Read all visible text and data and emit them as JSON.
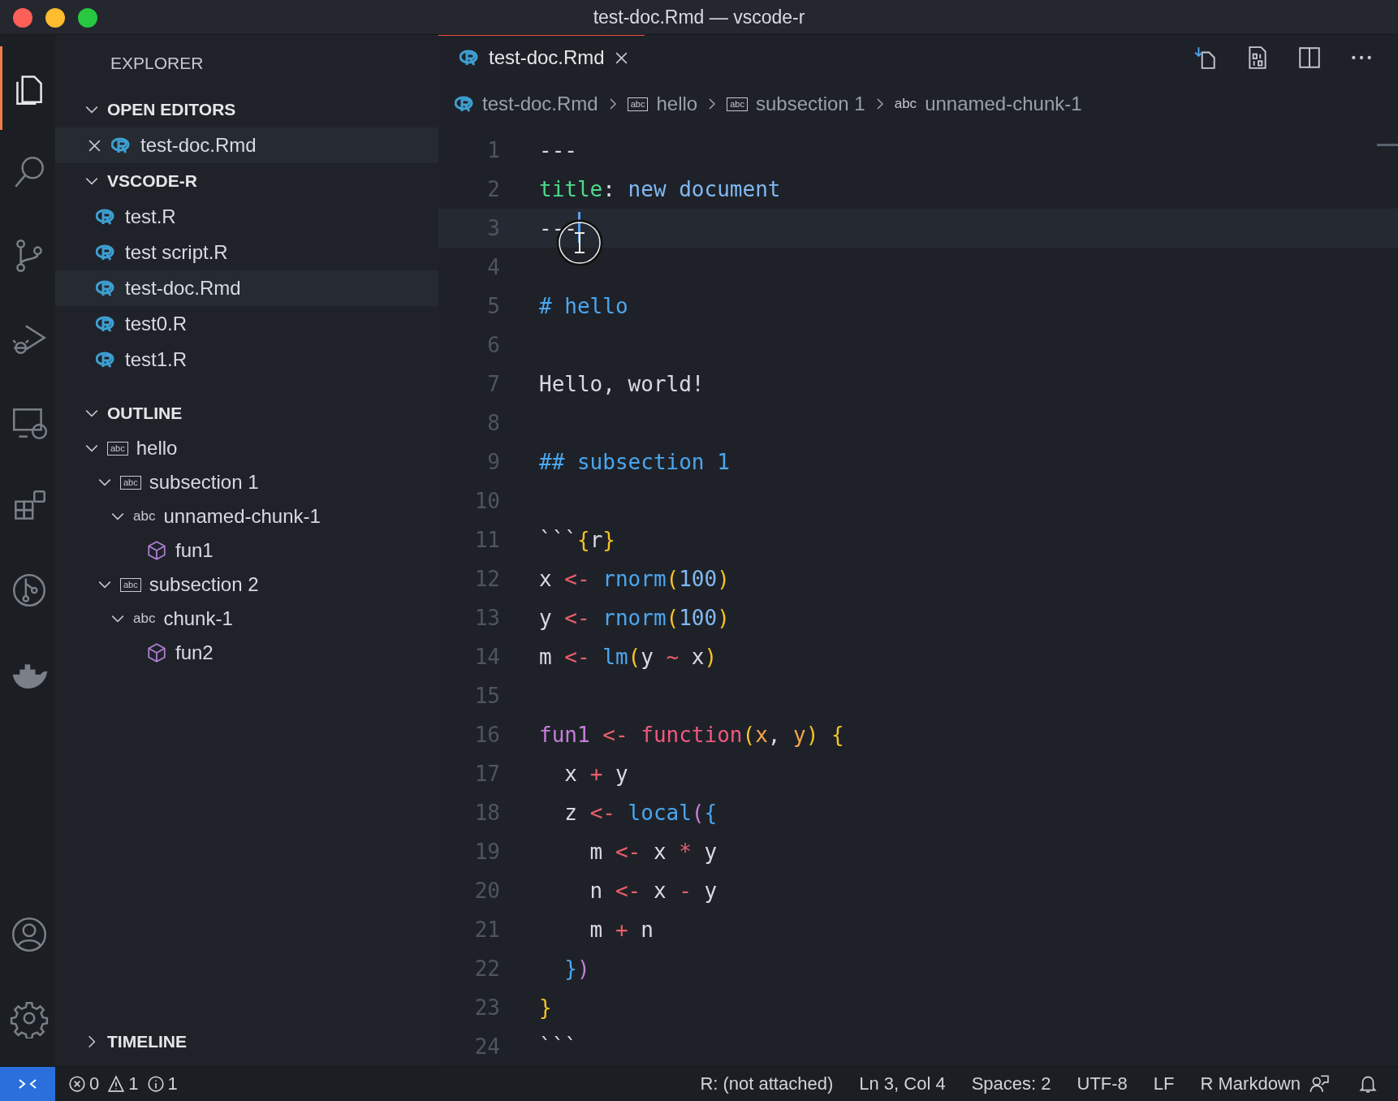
{
  "window": {
    "title": "test-doc.Rmd — vscode-r"
  },
  "activity_bar": {
    "top": [
      {
        "kind": "files",
        "selected": true
      },
      {
        "kind": "search",
        "selected": false
      },
      {
        "kind": "source-control",
        "selected": false
      },
      {
        "kind": "run-debug",
        "selected": false
      },
      {
        "kind": "remote",
        "selected": false
      },
      {
        "kind": "extensions",
        "selected": false
      },
      {
        "kind": "git-graph",
        "selected": false
      },
      {
        "kind": "docker",
        "selected": false
      }
    ],
    "bottom": [
      {
        "kind": "account",
        "selected": false
      },
      {
        "kind": "settings",
        "selected": false
      }
    ]
  },
  "sidebar": {
    "title": "EXPLORER",
    "open_editors": {
      "title": "OPEN EDITORS",
      "expanded": true,
      "items": [
        {
          "label": "test-doc.Rmd",
          "selected": true
        }
      ]
    },
    "folder": {
      "title": "VSCODE-R",
      "expanded": true,
      "items": [
        {
          "label": "test.R",
          "selected": false
        },
        {
          "label": "test script.R",
          "selected": false
        },
        {
          "label": "test-doc.Rmd",
          "selected": true
        },
        {
          "label": "test0.R",
          "selected": false
        },
        {
          "label": "test1.R",
          "selected": false
        }
      ]
    },
    "outline": {
      "title": "OUTLINE",
      "expanded": true,
      "items": [
        {
          "label": "hello",
          "kind": "heading",
          "symbol": "abc",
          "expanded": true,
          "children": [
            {
              "label": "subsection 1",
              "kind": "heading",
              "symbol": "abc",
              "expanded": true,
              "children": [
                {
                  "label": "unnamed-chunk-1",
                  "kind": "chunk",
                  "symbol": "abc",
                  "expanded": true,
                  "children": [
                    {
                      "label": "fun1",
                      "kind": "function"
                    }
                  ]
                }
              ]
            },
            {
              "label": "subsection 2",
              "kind": "heading",
              "symbol": "abc",
              "expanded": true,
              "children": [
                {
                  "label": "chunk-1",
                  "kind": "chunk",
                  "symbol": "abc",
                  "expanded": true,
                  "children": [
                    {
                      "label": "fun2",
                      "kind": "function"
                    }
                  ]
                }
              ]
            }
          ]
        }
      ]
    },
    "timeline": {
      "title": "TIMELINE",
      "expanded": false
    }
  },
  "tabs": [
    {
      "label": "test-doc.Rmd",
      "selected": true
    }
  ],
  "breadcrumbs": [
    {
      "label": "test-doc.Rmd",
      "kind": "file"
    },
    {
      "label": "hello",
      "kind": "heading",
      "symbol": "abc"
    },
    {
      "label": "subsection 1",
      "kind": "heading",
      "symbol": "abc"
    },
    {
      "label": "unnamed-chunk-1",
      "kind": "chunk",
      "symbol": "abc"
    }
  ],
  "editor": {
    "lines": [
      {
        "number": "1",
        "current": false,
        "tokens": [
          {
            "text": "---",
            "kind": "plain"
          }
        ]
      },
      {
        "number": "2",
        "current": false,
        "tokens": [
          {
            "text": "title",
            "kind": "key"
          },
          {
            "text": ": ",
            "kind": "plain"
          },
          {
            "text": "new document",
            "kind": "value"
          }
        ]
      },
      {
        "number": "3",
        "current": true,
        "tokens": [
          {
            "text": "---",
            "kind": "plain"
          }
        ]
      },
      {
        "number": "4",
        "current": false
      },
      {
        "number": "5",
        "current": false,
        "tokens": [
          {
            "text": "# hello",
            "kind": "heading"
          }
        ]
      },
      {
        "number": "6",
        "current": false
      },
      {
        "number": "7",
        "current": false,
        "tokens": [
          {
            "text": "Hello, world!",
            "kind": "plain"
          }
        ]
      },
      {
        "number": "8",
        "current": false
      },
      {
        "number": "9",
        "current": false,
        "tokens": [
          {
            "text": "## subsection 1",
            "kind": "heading"
          }
        ]
      },
      {
        "number": "10",
        "current": false
      },
      {
        "number": "11",
        "current": false,
        "tokens": [
          {
            "text": "```",
            "kind": "plain"
          },
          {
            "text": "{",
            "kind": "b1"
          },
          {
            "text": "r",
            "kind": "plain"
          },
          {
            "text": "}",
            "kind": "b1"
          }
        ]
      },
      {
        "number": "12",
        "current": false,
        "tokens": [
          {
            "text": "x ",
            "kind": "plain"
          },
          {
            "text": "<-",
            "kind": "op"
          },
          {
            "text": " rnorm",
            "kind": "func"
          },
          {
            "text": "(",
            "kind": "b1"
          },
          {
            "text": "100",
            "kind": "number"
          },
          {
            "text": ")",
            "kind": "b1"
          }
        ]
      },
      {
        "number": "13",
        "current": false,
        "tokens": [
          {
            "text": "y ",
            "kind": "plain"
          },
          {
            "text": "<-",
            "kind": "op"
          },
          {
            "text": " rnorm",
            "kind": "func"
          },
          {
            "text": "(",
            "kind": "b1"
          },
          {
            "text": "100",
            "kind": "number"
          },
          {
            "text": ")",
            "kind": "b1"
          }
        ]
      },
      {
        "number": "14",
        "current": false,
        "tokens": [
          {
            "text": "m ",
            "kind": "plain"
          },
          {
            "text": "<-",
            "kind": "op"
          },
          {
            "text": " lm",
            "kind": "func"
          },
          {
            "text": "(",
            "kind": "b1"
          },
          {
            "text": "y ",
            "kind": "plain"
          },
          {
            "text": "~",
            "kind": "op"
          },
          {
            "text": " x",
            "kind": "plain"
          },
          {
            "text": ")",
            "kind": "b1"
          }
        ]
      },
      {
        "number": "15",
        "current": false
      },
      {
        "number": "16",
        "current": false,
        "tokens": [
          {
            "text": "fun1",
            "kind": "name"
          },
          {
            "text": " <-",
            "kind": "op"
          },
          {
            "text": " function",
            "kind": "keyword"
          },
          {
            "text": "(",
            "kind": "b1"
          },
          {
            "text": "x",
            "kind": "param"
          },
          {
            "text": ", ",
            "kind": "plain"
          },
          {
            "text": "y",
            "kind": "param"
          },
          {
            "text": ")",
            "kind": "b1"
          },
          {
            "text": " {",
            "kind": "b1"
          }
        ]
      },
      {
        "number": "17",
        "current": false,
        "tokens": [
          {
            "text": "  x ",
            "kind": "plain"
          },
          {
            "text": "+",
            "kind": "op"
          },
          {
            "text": " y",
            "kind": "plain"
          }
        ]
      },
      {
        "number": "18",
        "current": false,
        "tokens": [
          {
            "text": "  z ",
            "kind": "plain"
          },
          {
            "text": "<-",
            "kind": "op"
          },
          {
            "text": " local",
            "kind": "func"
          },
          {
            "text": "(",
            "kind": "b2"
          },
          {
            "text": "{",
            "kind": "b3"
          }
        ]
      },
      {
        "number": "19",
        "current": false,
        "tokens": [
          {
            "text": "    m ",
            "kind": "plain"
          },
          {
            "text": "<-",
            "kind": "op"
          },
          {
            "text": " x ",
            "kind": "plain"
          },
          {
            "text": "*",
            "kind": "op"
          },
          {
            "text": " y",
            "kind": "plain"
          }
        ]
      },
      {
        "number": "20",
        "current": false,
        "tokens": [
          {
            "text": "    n ",
            "kind": "plain"
          },
          {
            "text": "<-",
            "kind": "op"
          },
          {
            "text": " x ",
            "kind": "plain"
          },
          {
            "text": "-",
            "kind": "op"
          },
          {
            "text": " y",
            "kind": "plain"
          }
        ]
      },
      {
        "number": "21",
        "current": false,
        "tokens": [
          {
            "text": "    m ",
            "kind": "plain"
          },
          {
            "text": "+",
            "kind": "op"
          },
          {
            "text": " n",
            "kind": "plain"
          }
        ]
      },
      {
        "number": "22",
        "current": false,
        "tokens": [
          {
            "text": "  }",
            "kind": "b3"
          },
          {
            "text": ")",
            "kind": "b2"
          }
        ]
      },
      {
        "number": "23",
        "current": false,
        "tokens": [
          {
            "text": "}",
            "kind": "b1"
          }
        ]
      },
      {
        "number": "24",
        "current": false,
        "tokens": [
          {
            "text": "```",
            "kind": "plain"
          }
        ]
      }
    ]
  },
  "status_bar": {
    "problems": [
      {
        "kind": "error",
        "count": "0"
      },
      {
        "kind": "warning",
        "count": "1"
      },
      {
        "kind": "info",
        "count": "1"
      }
    ],
    "items": [
      "R: (not attached)",
      "Ln 3, Col 4",
      "Spaces: 2",
      "UTF-8",
      "LF",
      "R Markdown"
    ]
  }
}
